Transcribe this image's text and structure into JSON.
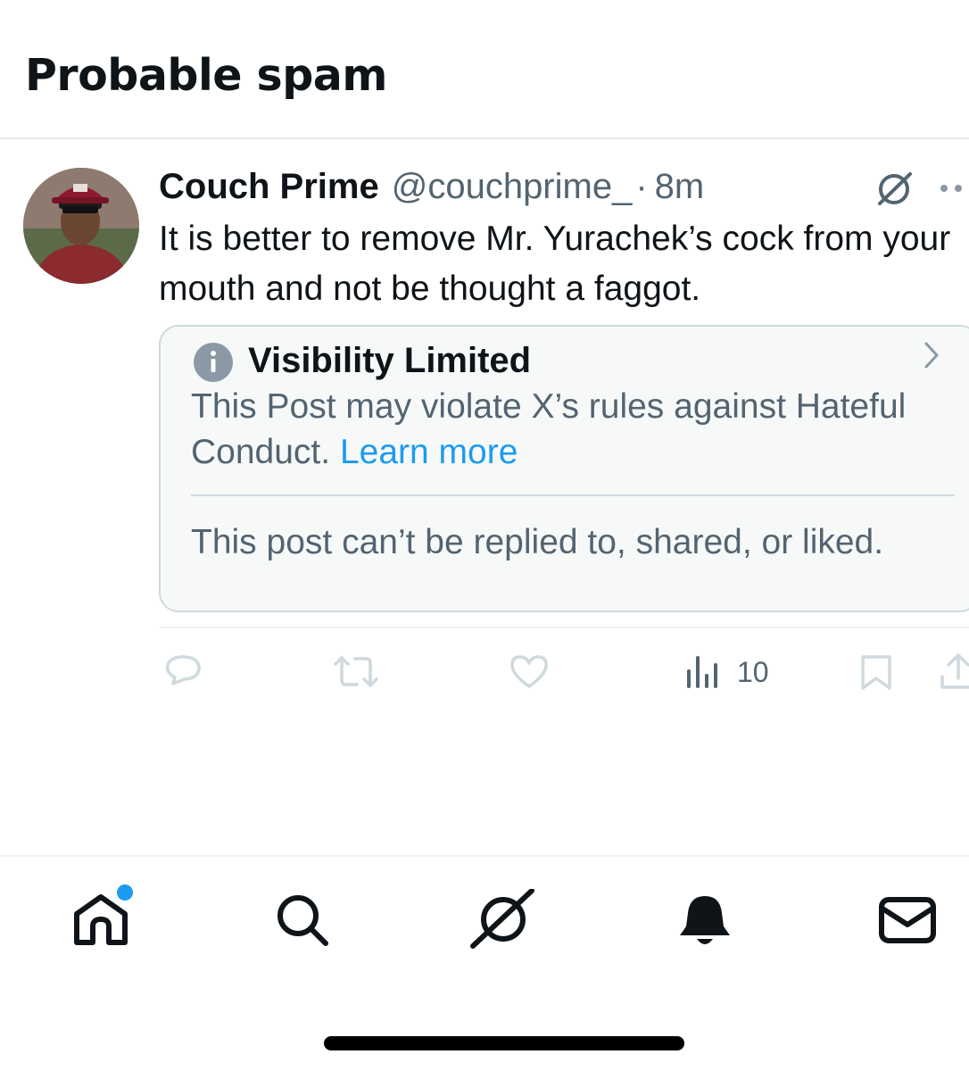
{
  "page": {
    "title": "Probable spam"
  },
  "post": {
    "display_name": "Couch Prime",
    "handle": "@couchprime_",
    "separator": "·",
    "time": "8m",
    "text": "It is better to remove Mr. Yurachek’s cock from your mouth and not be thought a faggot.",
    "avatar_icon": "user-avatar-photo",
    "notice": {
      "title": "Visibility Limited",
      "body": "This Post may violate X’s rules against Hateful Conduct.",
      "link": "Learn more",
      "footer": "This post can’t be replied to, shared, or liked."
    },
    "actions": {
      "reply_icon": "reply-icon",
      "repost_icon": "repost-icon",
      "like_icon": "like-icon",
      "views_icon": "views-icon",
      "views_count": "10",
      "bookmark_icon": "bookmark-icon",
      "share_icon": "share-icon"
    }
  },
  "bottom_nav": {
    "items": [
      "home",
      "search",
      "grok",
      "notifications",
      "messages"
    ],
    "home_has_badge": true
  },
  "colors": {
    "accent": "#1d9bf0",
    "text_primary": "#0f1419",
    "text_secondary": "#536471",
    "notice_bg": "#f7f9f9",
    "notice_border": "#cfd9de"
  }
}
